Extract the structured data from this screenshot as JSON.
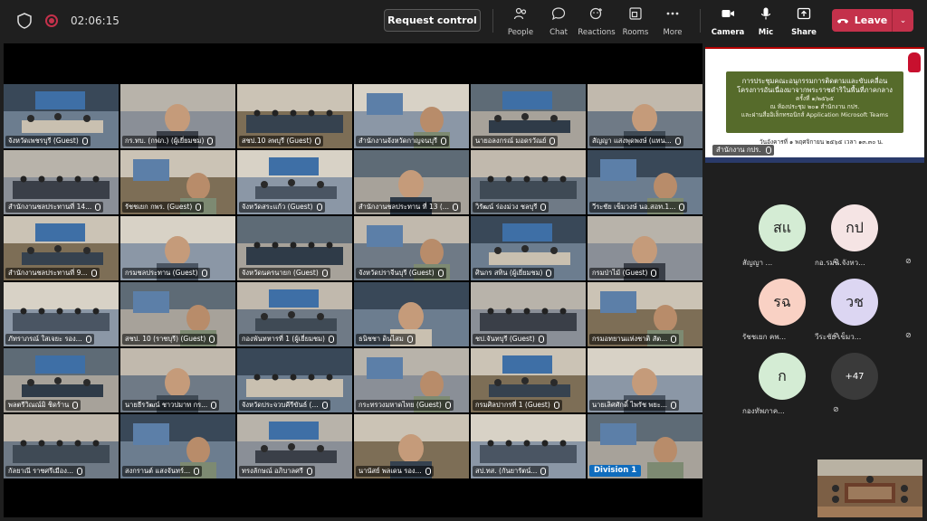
{
  "topbar": {
    "timer": "02:06:15",
    "request_control": "Request control",
    "tools": [
      "People",
      "Chat",
      "Reactions",
      "Rooms",
      "More"
    ],
    "media": [
      "Camera",
      "Mic",
      "Share"
    ],
    "leave": "Leave"
  },
  "tiles": [
    "จังหวัดเพชรบุรี (Guest)",
    "กร.ทบ. (กฟภ.) (ผู้เยี่ยมชม)",
    "สชป.10 ลพบุรี (Guest)",
    "สำนักงานจังหวัดกาญจนบุรี",
    "นายอลงกรณ์ มอดรวัณย์",
    "สัญญา แสงพุดพงษ์ (แทน...",
    "สำนักงานชลประทานที่ 14...",
    "รัชชเยก กพร. (Guest)",
    "จังหวัดสระแก้ว (Guest)",
    "สำนักงานชลประทาน ที่ 13 (...",
    "วิรัฒน์ ร่องม่วง ชลบุรี",
    "วีระชัย เข็มวงษ์ นอ.สอท.1...",
    "สำนักงานชลประทานที่ 9...",
    "กรมชลประทาน (Guest)",
    "จังหวัดนครนายก (Guest)",
    "จังหวัดปราจีนบุรี (Guest)",
    "ศินกร สทิน (ผู้เยี่ยมชม)",
    "กรมป่าไม้ (Guest)",
    "ภัทราภรณ์ ใสเจยะ รอง...",
    "สชป. 10 (ราชบุรี) (Guest)",
    "กองพันทหารที่ 1 (ผู้เยี่ยมชม)",
    "ธนิชชา ดินไสม",
    "ชป.จันทบุรี (Guest)",
    "กรมอทยานแห่งชาติ สัต...",
    "พลตรีวิณณ์มิ ชิดร้าน",
    "นายธีรวัฒน์ ชาวปมาท กร...",
    "จังหวัดประจวบคีรีขันธ์ (...",
    "กระทรวงมหาดไทย (Guest)",
    "กรมศิลปากรที่ 1 (Guest)",
    "นายเลิศศักดิ์ ไพรัช พยะ...",
    "กัลยาณี ราชศรีเมือง...",
    "สงกรานต์ แสงจันทร์...",
    "ทรงลักษณ์ อภิบาลศรี",
    "นานัสย์ พลเดน รอง...",
    "สป.ทส. (กันยารัตน์...",
    "กอ.รมน.จังหวัด ป.จ..."
  ],
  "division_tag": "Division 1",
  "screenshare": {
    "line1": "การประชุมคณะอนุกรรมการติดตามและขับเคลื่อน",
    "line2": "โครงการอันเนื่องมาจากพระราชดำริในพื้นที่ภาคกลาง",
    "line3": "ครั้งที่ ๑/๒๕๖๕",
    "line4": "ณ ห้องประชุม ๒๐๑ สำนักงาน กปร.",
    "line5": "และผ่านสื่ออิเล็กทรอนิกส์ Application Microsoft Teams",
    "date": "วันอังคารที่ ๑ พฤศจิกายน ๒๕๖๕ เวลา ๑๓.๓๐ น.",
    "owner": "สำนักงาน กปร."
  },
  "participants": [
    {
      "initials": "สแ",
      "name": "สัญญา ...",
      "color": "#d4ecd4"
    },
    {
      "initials": "กป",
      "name": "กอ.รมน.จังหว...",
      "color": "#f5e4e4"
    },
    {
      "initials": "รฉ",
      "name": "รัชชเยก คพ...",
      "color": "#f9d1c4"
    },
    {
      "initials": "วช",
      "name": "วีระชัย เข็มว...",
      "color": "#dcd6f2"
    },
    {
      "initials": "ก",
      "name": "กองทัพภาค...",
      "color": "#d4ecd4"
    }
  ],
  "more_participants": "+47"
}
